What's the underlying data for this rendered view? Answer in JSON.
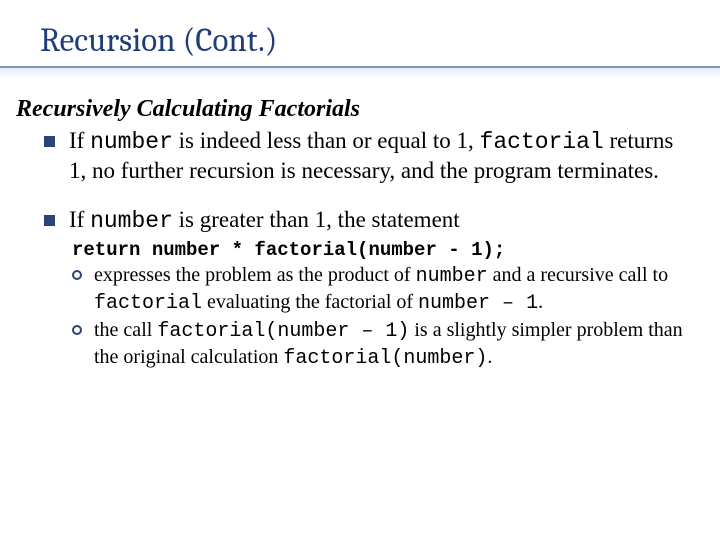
{
  "title": "Recursion (Cont.)",
  "subhead": "Recursively Calculating Factorials",
  "b1": {
    "pre": "If ",
    "c1": "number",
    "mid1": " is indeed less than or equal to 1, ",
    "c2": "factorial",
    "rest": " returns 1, no further recursion is necessary, and the program terminates."
  },
  "b2": {
    "pre": "If ",
    "c1": "number",
    "rest": " is greater than 1, the statement"
  },
  "codeline": "return number * factorial(number - 1);",
  "s1": {
    "t1": "expresses the problem as the product of ",
    "c1": "number",
    "t2": " and a recursive call to ",
    "c2": "factorial",
    "t3": " evaluating the factorial of ",
    "c3": "number – 1",
    "t4": "."
  },
  "s2": {
    "t1": "the call ",
    "c1": "factorial(number – 1)",
    "t2": " is a slightly simpler problem than the original calculation ",
    "c2": "factorial(number)",
    "t3": "."
  }
}
